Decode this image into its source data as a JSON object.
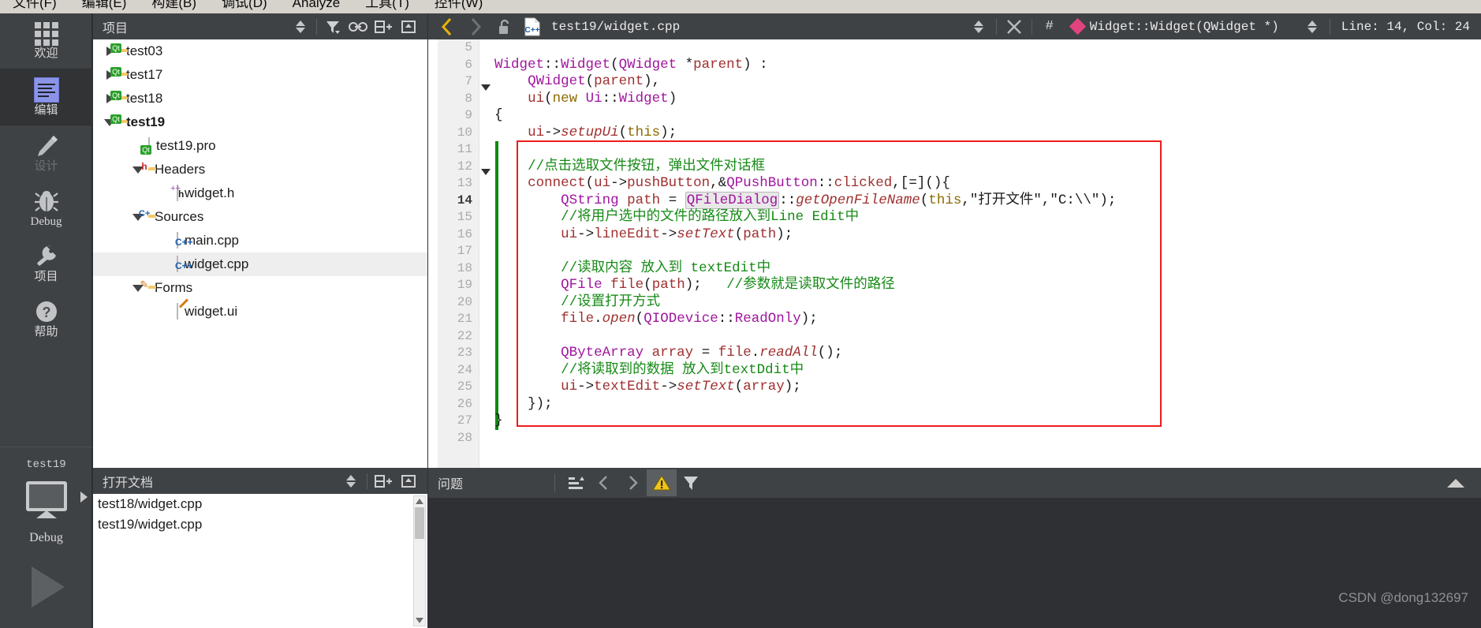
{
  "menubar": {
    "items": [
      "文件(F)",
      "编辑(E)",
      "构建(B)",
      "调试(D)",
      "Analyze",
      "工具(T)",
      "控件(W)"
    ]
  },
  "modebar": {
    "items": [
      {
        "label": "欢迎",
        "icon": "grid-icon",
        "state": "normal"
      },
      {
        "label": "编辑",
        "icon": "edit-lines-icon",
        "state": "selected"
      },
      {
        "label": "设计",
        "icon": "pencil-icon",
        "state": "disabled"
      },
      {
        "label": "Debug",
        "icon": "bug-icon",
        "state": "normal"
      },
      {
        "label": "项目",
        "icon": "wrench-icon",
        "state": "normal"
      },
      {
        "label": "帮助",
        "icon": "question-circle-icon",
        "state": "normal"
      }
    ],
    "kit": {
      "project_name": "test19",
      "build_config": "Debug",
      "monitor_icon": "monitor-icon",
      "run_icon": "run-triangle-icon"
    }
  },
  "projects_panel": {
    "title": "项目",
    "toolbar_icons": [
      "sync-updown-icon",
      "filter-icon",
      "link-icon",
      "split-add-icon",
      "close-split-icon"
    ],
    "tree": [
      {
        "label": "test03",
        "depth": 0,
        "twisty": "right",
        "icon": "qt-folder-icon",
        "selected": false,
        "bold": false
      },
      {
        "label": "test17",
        "depth": 0,
        "twisty": "right",
        "icon": "qt-folder-icon",
        "selected": false,
        "bold": false
      },
      {
        "label": "test18",
        "depth": 0,
        "twisty": "right",
        "icon": "qt-folder-icon",
        "selected": false,
        "bold": false
      },
      {
        "label": "test19",
        "depth": 0,
        "twisty": "down",
        "icon": "qt-folder-icon",
        "selected": false,
        "bold": true
      },
      {
        "label": "test19.pro",
        "depth": 1,
        "twisty": "none",
        "icon": "qt-pro-file-icon",
        "selected": false,
        "bold": false
      },
      {
        "label": "Headers",
        "depth": 1,
        "twisty": "down",
        "icon": "h-folder-icon",
        "selected": false,
        "bold": false
      },
      {
        "label": "widget.h",
        "depth": 2,
        "twisty": "none",
        "icon": "h-file-icon",
        "selected": false,
        "bold": false
      },
      {
        "label": "Sources",
        "depth": 1,
        "twisty": "down",
        "icon": "cpp-folder-icon",
        "selected": false,
        "bold": false
      },
      {
        "label": "main.cpp",
        "depth": 2,
        "twisty": "none",
        "icon": "cpp-file-icon",
        "selected": false,
        "bold": false
      },
      {
        "label": "widget.cpp",
        "depth": 2,
        "twisty": "none",
        "icon": "cpp-file-icon",
        "selected": true,
        "bold": false
      },
      {
        "label": "Forms",
        "depth": 1,
        "twisty": "down",
        "icon": "forms-folder-icon",
        "selected": false,
        "bold": false
      },
      {
        "label": "widget.ui",
        "depth": 2,
        "twisty": "none",
        "icon": "ui-file-icon",
        "selected": false,
        "bold": false
      }
    ]
  },
  "editor_toolbar": {
    "split_add_icon": "split-add-icon",
    "close_split_icon": "close-split-icon",
    "back_icon": "nav-back-icon",
    "forward_icon": "nav-forward-icon",
    "lock_icon": "unlocked-icon",
    "file_icon": "cpp-file-icon",
    "filename": "test19/widget.cpp",
    "file_selector_icon": "updown-selector-icon",
    "close_icon": "close-x-icon",
    "hash_icon": "#",
    "symbol_marker_icon": "pink-diamond-icon",
    "symbol": "Widget::Widget(QWidget *)",
    "symbol_selector_icon": "updown-selector-icon",
    "line_col": "Line: 14, Col: 24"
  },
  "editor": {
    "current_line": 14,
    "colors": {
      "comment": "#168a16",
      "type": "#a0159e",
      "keyword": "#8d6b00",
      "member": "#a03030",
      "plain": "#1a1a1a",
      "redbox": "#ee1c1c",
      "changebar": "#0f8a0f"
    },
    "lines": [
      {
        "n": 5,
        "fold": false,
        "text": ""
      },
      {
        "n": 6,
        "fold": false,
        "text": "Widget::Widget(QWidget *parent) :"
      },
      {
        "n": 7,
        "fold": false,
        "text": "    QWidget(parent),"
      },
      {
        "n": 8,
        "fold": true,
        "text": "    ui(new Ui::Widget)"
      },
      {
        "n": 9,
        "fold": false,
        "text": "{"
      },
      {
        "n": 10,
        "fold": false,
        "text": "    ui->setupUi(this);"
      },
      {
        "n": 11,
        "fold": false,
        "text": ""
      },
      {
        "n": 12,
        "fold": false,
        "text": "    //点击选取文件按钮，弹出文件对话框"
      },
      {
        "n": 13,
        "fold": true,
        "text": "    connect(ui->pushButton,&QPushButton::clicked,[=](){"
      },
      {
        "n": 14,
        "fold": false,
        "text": "        QString path = QFileDialog::getOpenFileName(this,\"打开文件\",\"C:\\\\\");"
      },
      {
        "n": 15,
        "fold": false,
        "text": "        //将用户选中的文件的路径放入到Line Edit中"
      },
      {
        "n": 16,
        "fold": false,
        "text": "        ui->lineEdit->setText(path);"
      },
      {
        "n": 17,
        "fold": false,
        "text": ""
      },
      {
        "n": 18,
        "fold": false,
        "text": "        //读取内容 放入到 textEdit中"
      },
      {
        "n": 19,
        "fold": false,
        "text": "        QFile file(path);   //参数就是读取文件的路径"
      },
      {
        "n": 20,
        "fold": false,
        "text": "        //设置打开方式"
      },
      {
        "n": 21,
        "fold": false,
        "text": "        file.open(QIODevice::ReadOnly);"
      },
      {
        "n": 22,
        "fold": false,
        "text": ""
      },
      {
        "n": 23,
        "fold": false,
        "text": "        QByteArray array = file.readAll();"
      },
      {
        "n": 24,
        "fold": false,
        "text": "        //将读取到的数据 放入到textDdit中"
      },
      {
        "n": 25,
        "fold": false,
        "text": "        ui->textEdit->setText(array);"
      },
      {
        "n": 26,
        "fold": false,
        "text": "    });"
      },
      {
        "n": 27,
        "fold": false,
        "text": "}"
      },
      {
        "n": 28,
        "fold": false,
        "text": ""
      }
    ]
  },
  "open_documents": {
    "title": "打开文档",
    "toolbar_icons": [
      "updown-selector-icon",
      "split-add-icon",
      "close-split-icon"
    ],
    "items": [
      "test18/widget.cpp",
      "test19/widget.cpp"
    ]
  },
  "issues_panel": {
    "title": "问题",
    "icons": [
      "sort-icon",
      "prev-issue-icon",
      "next-issue-icon",
      "warning-icon",
      "filter-icon",
      "expand-chevron-icon"
    ]
  },
  "watermark": "CSDN @dong132697"
}
